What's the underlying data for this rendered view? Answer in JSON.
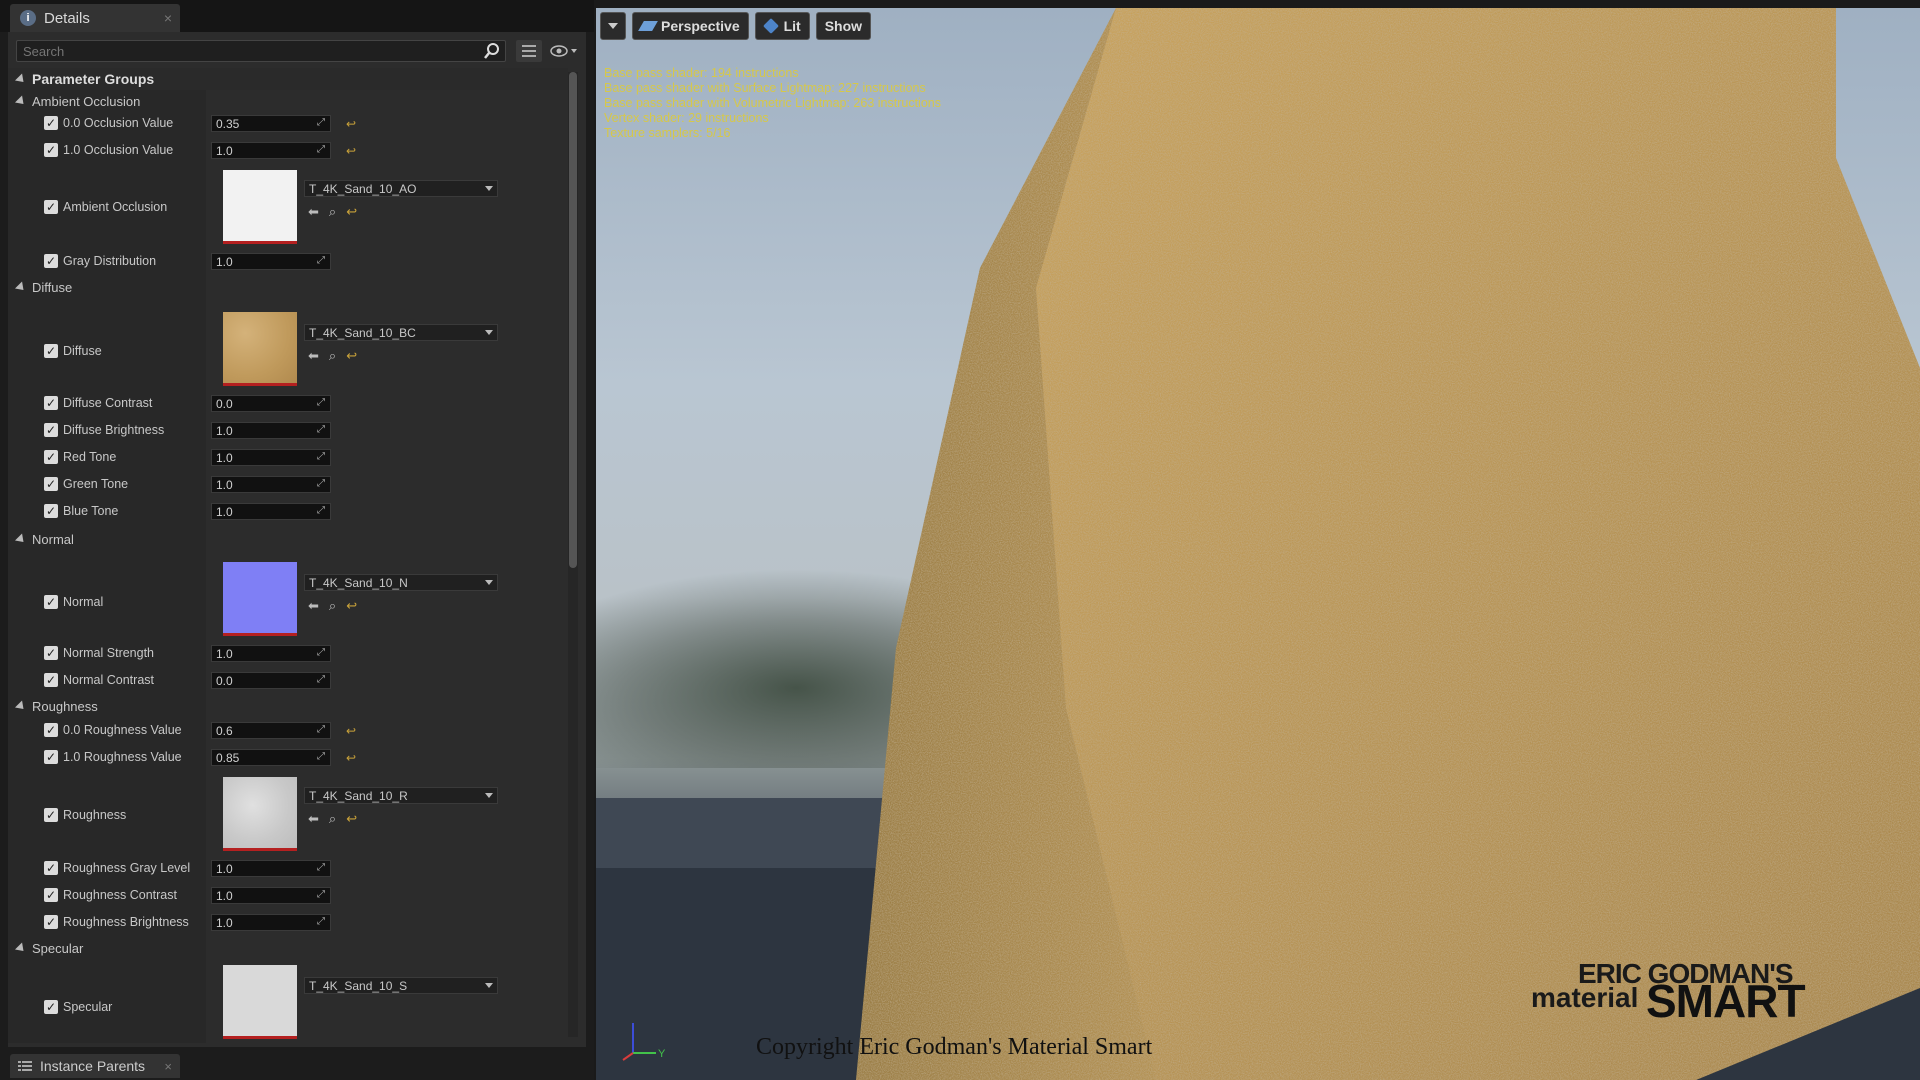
{
  "details_tab": {
    "title": "Details"
  },
  "search": {
    "placeholder": "Search"
  },
  "parameter_groups_label": "Parameter Groups",
  "groups": {
    "ambient_occlusion": "Ambient Occlusion",
    "diffuse": "Diffuse",
    "normal": "Normal",
    "roughness": "Roughness",
    "specular": "Specular"
  },
  "params": {
    "occ0": {
      "label": "0.0 Occlusion Value",
      "value": "0.35"
    },
    "occ1": {
      "label": "1.0 Occlusion Value",
      "value": "1.0"
    },
    "ao": {
      "label": "Ambient Occlusion",
      "asset": "T_4K_Sand_10_AO"
    },
    "gray": {
      "label": "Gray Distribution",
      "value": "1.0"
    },
    "diffuse": {
      "label": "Diffuse",
      "asset": "T_4K_Sand_10_BC"
    },
    "diff_contrast": {
      "label": "Diffuse Contrast",
      "value": "0.0"
    },
    "diff_bright": {
      "label": "Diffuse Brightness",
      "value": "1.0"
    },
    "red": {
      "label": "Red Tone",
      "value": "1.0"
    },
    "green": {
      "label": "Green Tone",
      "value": "1.0"
    },
    "blue": {
      "label": "Blue Tone",
      "value": "1.0"
    },
    "normal": {
      "label": "Normal",
      "asset": "T_4K_Sand_10_N"
    },
    "norm_strength": {
      "label": "Normal Strength",
      "value": "1.0"
    },
    "norm_contrast": {
      "label": "Normal Contrast",
      "value": "0.0"
    },
    "rough0": {
      "label": "0.0 Roughness Value",
      "value": "0.6"
    },
    "rough1": {
      "label": "1.0 Roughness Value",
      "value": "0.85"
    },
    "roughness": {
      "label": "Roughness",
      "asset": "T_4K_Sand_10_R"
    },
    "rough_gray": {
      "label": "Roughness Gray Level",
      "value": "1.0"
    },
    "rough_contrast": {
      "label": "Roughness Contrast",
      "value": "1.0"
    },
    "rough_bright": {
      "label": "Roughness Brightness",
      "value": "1.0"
    },
    "specular": {
      "label": "Specular",
      "asset": "T_4K_Sand_10_S"
    }
  },
  "bottom_tab": {
    "title": "Instance Parents"
  },
  "viewport": {
    "perspective": "Perspective",
    "lit": "Lit",
    "show": "Show",
    "stats": [
      "Base pass shader: 194 instructions",
      "Base pass shader with Surface Lightmap: 227 instructions",
      "Base pass shader with Volumetric Lightmap: 263 instructions",
      "Vertex shader: 29 instructions",
      "Texture samplers: 5/16"
    ],
    "copyright": "Copyright Eric Godman's Material Smart",
    "logo_line1": "ERIC GODMAN'S",
    "logo_line2": "material",
    "logo_line3": "SMART",
    "axis_y": "Y"
  },
  "colors": {
    "ao_thumb": "#f2f2f2",
    "diffuse_thumb": "#c8a46a",
    "normal_thumb": "#7f7ff5",
    "roughness_thumb": "#cfcfcf",
    "specular_thumb": "#d9d9d9",
    "reset_accent": "#c9a23a",
    "stats_text": "#d6c84a"
  }
}
